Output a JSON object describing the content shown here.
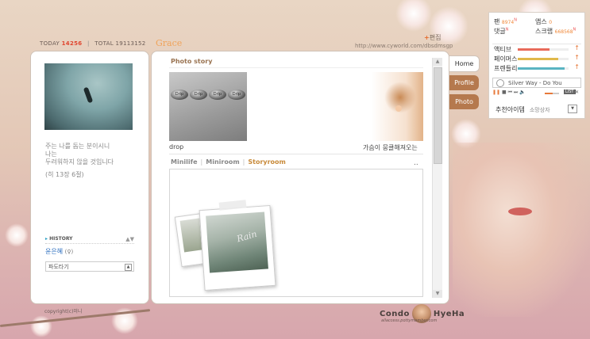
{
  "header": {
    "today_label": "TODAY",
    "today_value": "14256",
    "total_label": "TOTAL",
    "total_value": "19113152",
    "owner_name": "Grace",
    "edit_link": "편집",
    "url": "http://www.cyworld.com/dbsdmsgp"
  },
  "profile": {
    "lines": [
      "주는 나를 돕는 분이시니",
      "나는",
      "두려워하지 않을 것입니다",
      "(히 13장 6절)"
    ],
    "history_label": "HISTORY",
    "owner": "윤은혜",
    "gender_symbol": "(♀)",
    "wave_select": "파도타기"
  },
  "photo_story": {
    "title": "Photo story",
    "drip_text": "Drip",
    "photos": [
      {
        "caption": "drop"
      },
      {
        "caption": "가슴이 뭉클해져오는"
      }
    ]
  },
  "mini_tabs": [
    "Minilife",
    "Miniroom",
    "Storyroom"
  ],
  "mini_more": "..",
  "storyroom": {
    "polaroid_text": "Rain"
  },
  "scrollbar": {
    "up": "▲",
    "down": "▼"
  },
  "nav_tabs": [
    "Home",
    "Profile",
    "Photo"
  ],
  "stats": {
    "fan_label": "팬",
    "fan_value": "8974",
    "apps_label": "앱스",
    "apps_value": "0",
    "comment_label": "댓글",
    "scrap_label": "스크랩",
    "scrap_value": "668568",
    "new_mark": "N"
  },
  "gauges": [
    {
      "label": "액티브",
      "level": 0.62,
      "color": "#e86a5a"
    },
    {
      "label": "페이머스",
      "level": 0.8,
      "color": "#e0b84a"
    },
    {
      "label": "프렌들리",
      "level": 0.92,
      "color": "#59b4c2"
    }
  ],
  "gauge_up": "↑",
  "player": {
    "track": "Silver Way - Do You",
    "list_label": "LIST",
    "close_label": "✕",
    "controls": [
      "❚❚",
      "■",
      "⏮",
      "⏭",
      "🔈"
    ]
  },
  "recommend": {
    "label": "추천아이템",
    "shop": "소망상자",
    "dropdown": "▼"
  },
  "footer": {
    "copyright": "copyright(c)미니",
    "signature": "Condo",
    "signature2": "HyeHa",
    "signature_sub": "allaccess.pottymember.com"
  }
}
